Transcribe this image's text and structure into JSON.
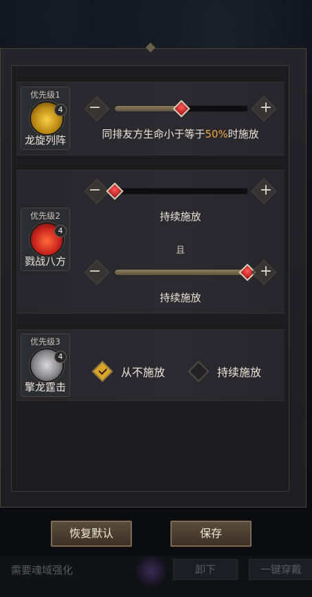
{
  "skills": [
    {
      "priority": "优先级1",
      "name": "龙旋列阵",
      "level": "4",
      "conditions": [
        {
          "slider_value_pct": 50,
          "text_pre": "同排友方生命小于等于",
          "text_hl": "50%",
          "text_post": "时施放"
        }
      ]
    },
    {
      "priority": "优先级2",
      "name": "戮战八方",
      "level": "4",
      "conditions": [
        {
          "slider_value_pct": 0,
          "text": "持续施放"
        },
        {
          "slider_value_pct": 100,
          "text": "持续施放"
        }
      ],
      "joiner": "且"
    },
    {
      "priority": "优先级3",
      "name": "擎龙霆击",
      "level": "4",
      "options": [
        {
          "label": "从不施放",
          "selected": true
        },
        {
          "label": "持续施放",
          "selected": false
        }
      ]
    }
  ],
  "buttons": {
    "restore": "恢复默认",
    "save": "保存"
  },
  "background_bar": {
    "hint": "需要魂域强化",
    "unload": "卸下",
    "equip_all": "一键穿戴"
  },
  "controls": {
    "minus": "−",
    "plus": "+"
  },
  "colors": {
    "highlight": "#f2a93b",
    "panel": "#1d1d22",
    "accent_gold": "#d9a429"
  }
}
